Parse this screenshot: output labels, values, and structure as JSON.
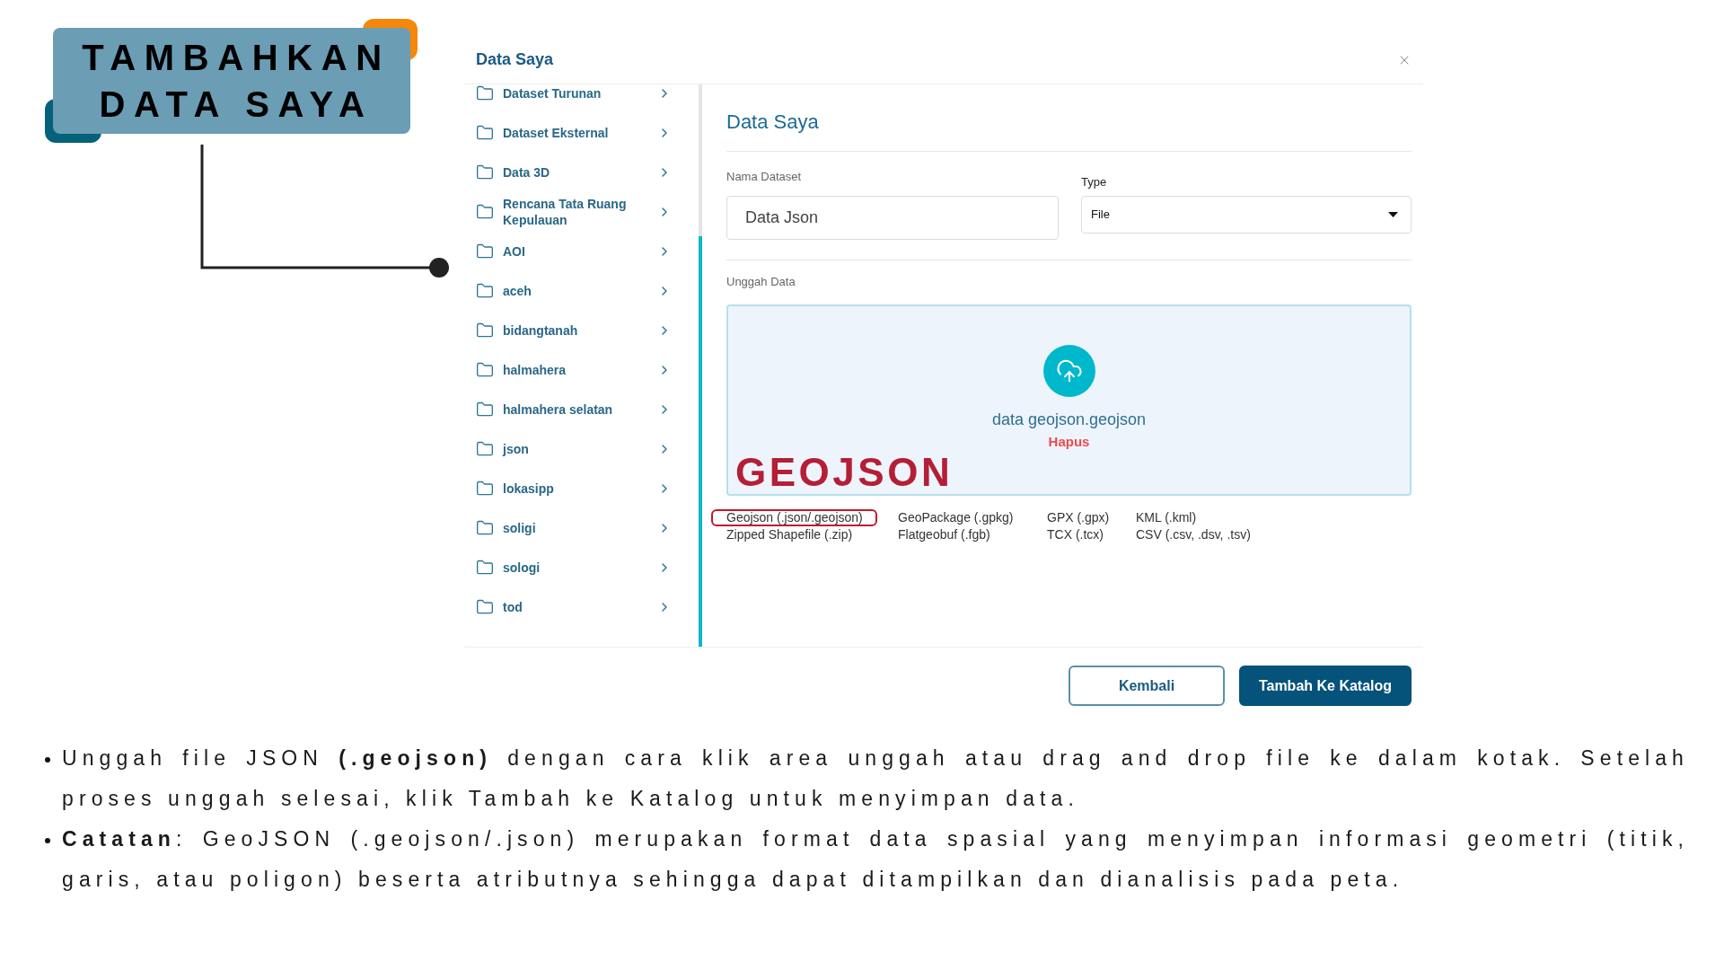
{
  "title_badge": {
    "text": "TAMBAHKAN DATA SAYA"
  },
  "dialog": {
    "title": "Data Saya",
    "sidebar": {
      "items": [
        {
          "label": "Dataset Turunan"
        },
        {
          "label": "Dataset Eksternal"
        },
        {
          "label": "Data 3D"
        },
        {
          "label": "Rencana Tata Ruang Kepulauan"
        },
        {
          "label": "AOI"
        },
        {
          "label": "aceh"
        },
        {
          "label": "bidangtanah"
        },
        {
          "label": "halmahera"
        },
        {
          "label": "halmahera selatan"
        },
        {
          "label": "json"
        },
        {
          "label": "lokasipp"
        },
        {
          "label": "soligi"
        },
        {
          "label": "sologi"
        },
        {
          "label": "tod"
        }
      ]
    },
    "panel": {
      "heading": "Data Saya",
      "name_field": {
        "label": "Nama Dataset",
        "value": "Data Json"
      },
      "type_field": {
        "label": "Type",
        "value": "File"
      },
      "upload": {
        "label": "Unggah Data",
        "file_name": "data geojson.geojson",
        "remove_label": "Hapus",
        "annotation": "GEOJSON"
      },
      "formats": [
        {
          "label": "Geojson (.json/.geojson)",
          "highlighted": true
        },
        {
          "label": "GeoPackage (.gpkg)",
          "highlighted": false
        },
        {
          "label": "GPX (.gpx)",
          "highlighted": false
        },
        {
          "label": "KML (.kml)",
          "highlighted": false
        },
        {
          "label": "Zipped Shapefile (.zip)",
          "highlighted": false
        },
        {
          "label": "Flatgeobuf (.fgb)",
          "highlighted": false
        },
        {
          "label": "TCX (.tcx)",
          "highlighted": false
        },
        {
          "label": "CSV (.csv, .dsv, .tsv)",
          "highlighted": false
        }
      ]
    },
    "buttons": [
      {
        "label": "Kembali",
        "kind": "secondary"
      },
      {
        "label": "Tambah Ke Katalog",
        "kind": "primary"
      }
    ]
  },
  "notes": [
    {
      "text": "Unggah file JSON **(.geojson)** dengan cara klik area unggah atau drag and drop file ke dalam kotak. Setelah proses unggah selesai, klik Tambah ke Katalog untuk menyimpan data."
    },
    {
      "text": "**Catatan**: GeoJSON (.geojson/.json) merupakan format data spasial yang menyimpan informasi geometri (titik, garis, atau poligon) beserta atributnya sehingga dapat ditampilkan dan dianalisis pada peta."
    }
  ]
}
